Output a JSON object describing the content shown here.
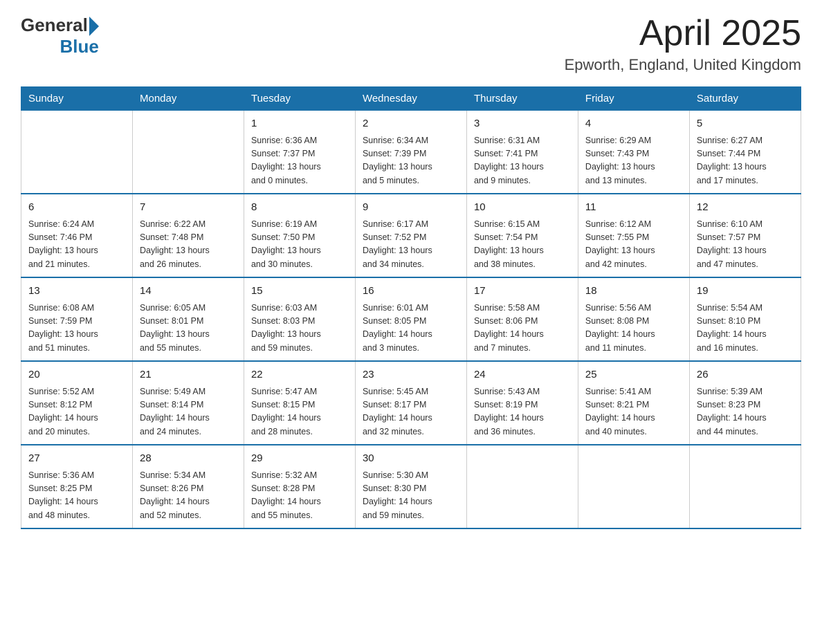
{
  "header": {
    "logo_general": "General",
    "logo_blue": "Blue",
    "title": "April 2025",
    "subtitle": "Epworth, England, United Kingdom"
  },
  "weekdays": [
    "Sunday",
    "Monday",
    "Tuesday",
    "Wednesday",
    "Thursday",
    "Friday",
    "Saturday"
  ],
  "weeks": [
    [
      {
        "day": "",
        "info": ""
      },
      {
        "day": "",
        "info": ""
      },
      {
        "day": "1",
        "info": "Sunrise: 6:36 AM\nSunset: 7:37 PM\nDaylight: 13 hours\nand 0 minutes."
      },
      {
        "day": "2",
        "info": "Sunrise: 6:34 AM\nSunset: 7:39 PM\nDaylight: 13 hours\nand 5 minutes."
      },
      {
        "day": "3",
        "info": "Sunrise: 6:31 AM\nSunset: 7:41 PM\nDaylight: 13 hours\nand 9 minutes."
      },
      {
        "day": "4",
        "info": "Sunrise: 6:29 AM\nSunset: 7:43 PM\nDaylight: 13 hours\nand 13 minutes."
      },
      {
        "day": "5",
        "info": "Sunrise: 6:27 AM\nSunset: 7:44 PM\nDaylight: 13 hours\nand 17 minutes."
      }
    ],
    [
      {
        "day": "6",
        "info": "Sunrise: 6:24 AM\nSunset: 7:46 PM\nDaylight: 13 hours\nand 21 minutes."
      },
      {
        "day": "7",
        "info": "Sunrise: 6:22 AM\nSunset: 7:48 PM\nDaylight: 13 hours\nand 26 minutes."
      },
      {
        "day": "8",
        "info": "Sunrise: 6:19 AM\nSunset: 7:50 PM\nDaylight: 13 hours\nand 30 minutes."
      },
      {
        "day": "9",
        "info": "Sunrise: 6:17 AM\nSunset: 7:52 PM\nDaylight: 13 hours\nand 34 minutes."
      },
      {
        "day": "10",
        "info": "Sunrise: 6:15 AM\nSunset: 7:54 PM\nDaylight: 13 hours\nand 38 minutes."
      },
      {
        "day": "11",
        "info": "Sunrise: 6:12 AM\nSunset: 7:55 PM\nDaylight: 13 hours\nand 42 minutes."
      },
      {
        "day": "12",
        "info": "Sunrise: 6:10 AM\nSunset: 7:57 PM\nDaylight: 13 hours\nand 47 minutes."
      }
    ],
    [
      {
        "day": "13",
        "info": "Sunrise: 6:08 AM\nSunset: 7:59 PM\nDaylight: 13 hours\nand 51 minutes."
      },
      {
        "day": "14",
        "info": "Sunrise: 6:05 AM\nSunset: 8:01 PM\nDaylight: 13 hours\nand 55 minutes."
      },
      {
        "day": "15",
        "info": "Sunrise: 6:03 AM\nSunset: 8:03 PM\nDaylight: 13 hours\nand 59 minutes."
      },
      {
        "day": "16",
        "info": "Sunrise: 6:01 AM\nSunset: 8:05 PM\nDaylight: 14 hours\nand 3 minutes."
      },
      {
        "day": "17",
        "info": "Sunrise: 5:58 AM\nSunset: 8:06 PM\nDaylight: 14 hours\nand 7 minutes."
      },
      {
        "day": "18",
        "info": "Sunrise: 5:56 AM\nSunset: 8:08 PM\nDaylight: 14 hours\nand 11 minutes."
      },
      {
        "day": "19",
        "info": "Sunrise: 5:54 AM\nSunset: 8:10 PM\nDaylight: 14 hours\nand 16 minutes."
      }
    ],
    [
      {
        "day": "20",
        "info": "Sunrise: 5:52 AM\nSunset: 8:12 PM\nDaylight: 14 hours\nand 20 minutes."
      },
      {
        "day": "21",
        "info": "Sunrise: 5:49 AM\nSunset: 8:14 PM\nDaylight: 14 hours\nand 24 minutes."
      },
      {
        "day": "22",
        "info": "Sunrise: 5:47 AM\nSunset: 8:15 PM\nDaylight: 14 hours\nand 28 minutes."
      },
      {
        "day": "23",
        "info": "Sunrise: 5:45 AM\nSunset: 8:17 PM\nDaylight: 14 hours\nand 32 minutes."
      },
      {
        "day": "24",
        "info": "Sunrise: 5:43 AM\nSunset: 8:19 PM\nDaylight: 14 hours\nand 36 minutes."
      },
      {
        "day": "25",
        "info": "Sunrise: 5:41 AM\nSunset: 8:21 PM\nDaylight: 14 hours\nand 40 minutes."
      },
      {
        "day": "26",
        "info": "Sunrise: 5:39 AM\nSunset: 8:23 PM\nDaylight: 14 hours\nand 44 minutes."
      }
    ],
    [
      {
        "day": "27",
        "info": "Sunrise: 5:36 AM\nSunset: 8:25 PM\nDaylight: 14 hours\nand 48 minutes."
      },
      {
        "day": "28",
        "info": "Sunrise: 5:34 AM\nSunset: 8:26 PM\nDaylight: 14 hours\nand 52 minutes."
      },
      {
        "day": "29",
        "info": "Sunrise: 5:32 AM\nSunset: 8:28 PM\nDaylight: 14 hours\nand 55 minutes."
      },
      {
        "day": "30",
        "info": "Sunrise: 5:30 AM\nSunset: 8:30 PM\nDaylight: 14 hours\nand 59 minutes."
      },
      {
        "day": "",
        "info": ""
      },
      {
        "day": "",
        "info": ""
      },
      {
        "day": "",
        "info": ""
      }
    ]
  ]
}
